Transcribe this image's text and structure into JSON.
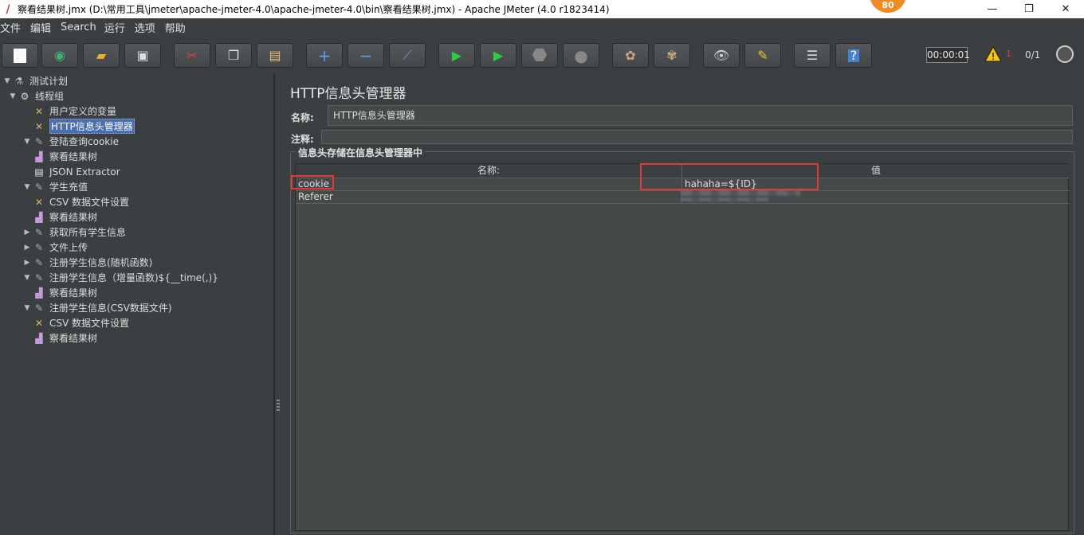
{
  "window": {
    "title": "察看结果树.jmx (D:\\常用工具\\jmeter\\apache-jmeter-4.0\\apache-jmeter-4.0\\bin\\察看结果树.jmx) - Apache JMeter (4.0 r1823414)",
    "badge": "80"
  },
  "menu": [
    "文件",
    "编辑",
    "Search",
    "运行",
    "选项",
    "帮助"
  ],
  "toolbar": {
    "buttons": [
      "new-icon",
      "templates-icon",
      "open-icon",
      "save-icon",
      "cut-icon",
      "copy-icon",
      "paste-icon",
      "expand-icon",
      "collapse-icon",
      "toggle-icon",
      "start-icon",
      "start-no-pause-icon",
      "stop-icon",
      "shutdown-icon",
      "clear-icon",
      "clear-all-icon",
      "search-icon",
      "reset-search-icon",
      "function-helper-icon",
      "help-icon"
    ],
    "timer": "00:00:01",
    "warnings": "1",
    "threads": "0/1"
  },
  "tree": [
    {
      "label": "测试计划",
      "icon": "test-plan-icon",
      "toggle": "▼",
      "level": 0
    },
    {
      "label": "线程组",
      "icon": "thread-group-icon",
      "toggle": "▼",
      "level": 1
    },
    {
      "label": "用户定义的变量",
      "icon": "config-icon",
      "toggle": "",
      "level": 2
    },
    {
      "label": "HTTP信息头管理器",
      "icon": "config-icon",
      "toggle": "",
      "level": 2,
      "selected": true
    },
    {
      "label": "登陆查询cookie",
      "icon": "sampler-icon",
      "toggle": "▼",
      "level": 2
    },
    {
      "label": "察看结果树",
      "icon": "listener-icon",
      "toggle": "",
      "level": 3
    },
    {
      "label": "JSON Extractor",
      "icon": "extractor-icon",
      "toggle": "",
      "level": 3
    },
    {
      "label": "学生充值",
      "icon": "sampler-icon",
      "toggle": "▼",
      "level": 2
    },
    {
      "label": "CSV 数据文件设置",
      "icon": "config-icon",
      "toggle": "",
      "level": 3
    },
    {
      "label": "察看结果树",
      "icon": "listener-icon",
      "toggle": "",
      "level": 3
    },
    {
      "label": "获取所有学生信息",
      "icon": "sampler-icon",
      "toggle": "▶",
      "level": 2
    },
    {
      "label": "文件上传",
      "icon": "sampler-icon",
      "toggle": "▶",
      "level": 2
    },
    {
      "label": "注册学生信息(随机函数)",
      "icon": "sampler-icon",
      "toggle": "▶",
      "level": 2
    },
    {
      "label": "注册学生信息（增量函数)${__time(,)}",
      "icon": "sampler-icon",
      "toggle": "▼",
      "level": 2
    },
    {
      "label": "察看结果树",
      "icon": "listener-icon",
      "toggle": "",
      "level": 3
    },
    {
      "label": "注册学生信息(CSV数据文件)",
      "icon": "sampler-icon",
      "toggle": "▼",
      "level": 2
    },
    {
      "label": "CSV 数据文件设置",
      "icon": "config-icon",
      "toggle": "",
      "level": 3
    },
    {
      "label": "察看结果树",
      "icon": "listener-icon",
      "toggle": "",
      "level": 3
    }
  ],
  "panel": {
    "title": "HTTP信息头管理器",
    "name_label": "名称:",
    "name_value": "HTTP信息头管理器",
    "comment_label": "注释:",
    "comment_value": "",
    "group_title": "信息头存储在信息头管理器中",
    "columns": [
      "名称:",
      "值"
    ],
    "rows": [
      {
        "name": "cookie",
        "value": "hahaha=${ID}"
      },
      {
        "name": "Referer",
        "value": ""
      }
    ]
  },
  "colors": {
    "background": "#3c3f41",
    "selection": "#4b6eaf",
    "highlight_box": "#e03a3a"
  }
}
